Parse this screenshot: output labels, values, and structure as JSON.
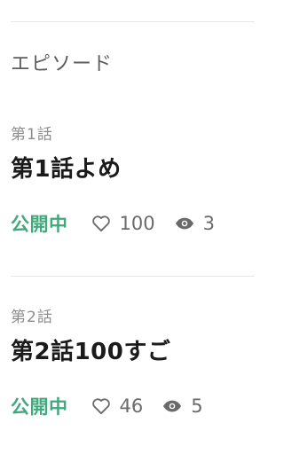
{
  "section": {
    "title": "エピソード"
  },
  "episodes": [
    {
      "number": "第1話",
      "title": "第1話よめ",
      "status": "公開中",
      "likes": "100",
      "views": "3"
    },
    {
      "number": "第2話",
      "title": "第2話100すご",
      "status": "公開中",
      "likes": "46",
      "views": "5"
    }
  ],
  "colors": {
    "status_green": "#41a87c",
    "title_text": "#1b1b1b",
    "muted_text": "#8d8d8d",
    "meta_text": "#6a6a6a",
    "divider": "#e7e7e7"
  },
  "icons": {
    "likes": "heart-outline-icon",
    "views": "eye-icon"
  }
}
